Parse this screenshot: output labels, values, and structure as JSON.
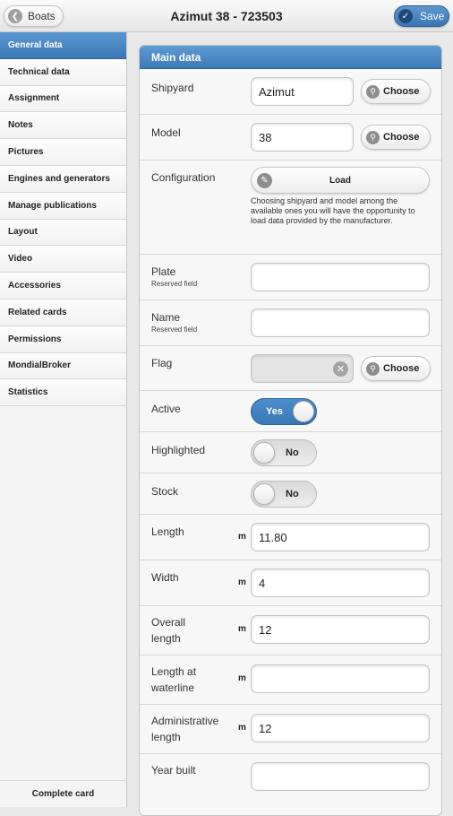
{
  "header": {
    "back_label": "Boats",
    "title": "Azimut 38 - 723503",
    "save_label": "Save"
  },
  "sidebar": {
    "items": [
      {
        "label": "General data"
      },
      {
        "label": "Technical data"
      },
      {
        "label": "Assignment"
      },
      {
        "label": "Notes"
      },
      {
        "label": "Pictures"
      },
      {
        "label": "Engines and generators"
      },
      {
        "label": "Manage publications"
      },
      {
        "label": "Layout"
      },
      {
        "label": "Video"
      },
      {
        "label": "Accessories"
      },
      {
        "label": "Related cards"
      },
      {
        "label": "Permissions"
      },
      {
        "label": "MondialBroker"
      },
      {
        "label": "Statistics"
      }
    ],
    "active_index": 0,
    "footer_label": "Complete card"
  },
  "panel": {
    "title": "Main data",
    "choose_label": "Choose",
    "reserved_label": "Reserved field",
    "unit": "m",
    "shipyard": {
      "label": "Shipyard",
      "value": "Azimut"
    },
    "model": {
      "label": "Model",
      "value": "38"
    },
    "configuration": {
      "label": "Configuration",
      "load_label": "Load",
      "help": "Choosing shipyard and model among the available ones you will have the opportunity to load data provided by the manufacturer."
    },
    "plate": {
      "label": "Plate",
      "value": ""
    },
    "name": {
      "label": "Name",
      "value": ""
    },
    "flag": {
      "label": "Flag",
      "value": ""
    },
    "active": {
      "label": "Active",
      "state": "Yes"
    },
    "highlighted": {
      "label": "Highlighted",
      "state": "No"
    },
    "stock": {
      "label": "Stock",
      "state": "No"
    },
    "length": {
      "label": "Length",
      "value": "11.80"
    },
    "width": {
      "label": "Width",
      "value": "4"
    },
    "overall_length": {
      "label": "Overall length",
      "value": "12"
    },
    "waterline_length": {
      "label": "Length at waterline",
      "value": ""
    },
    "administrative_length": {
      "label": "Administrative length",
      "value": "12"
    },
    "year_built": {
      "label": "Year built",
      "value": ""
    }
  },
  "colors": {
    "accent": "#3e7ab8",
    "header_bg": "#f0f0f0",
    "panel_bg": "#f7f7f7"
  }
}
